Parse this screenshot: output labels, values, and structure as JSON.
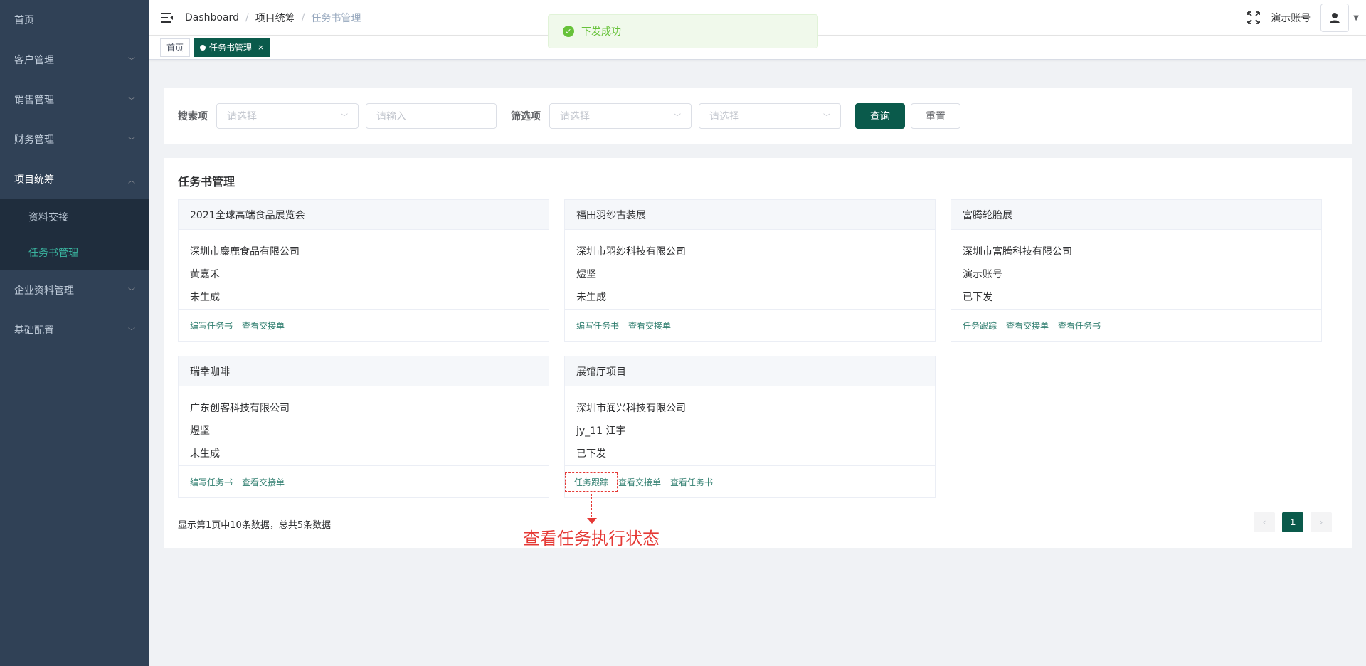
{
  "sidebar": {
    "items": [
      {
        "label": "首页",
        "has_children": false
      },
      {
        "label": "客户管理",
        "has_children": true
      },
      {
        "label": "销售管理",
        "has_children": true
      },
      {
        "label": "财务管理",
        "has_children": true
      },
      {
        "label": "项目统筹",
        "has_children": true,
        "open": true
      },
      {
        "label": "企业资料管理",
        "has_children": true
      },
      {
        "label": "基础配置",
        "has_children": true
      }
    ],
    "submenu": [
      {
        "label": "资料交接"
      },
      {
        "label": "任务书管理",
        "active": true
      }
    ]
  },
  "navbar": {
    "breadcrumb": [
      "Dashboard",
      "项目统筹",
      "任务书管理"
    ],
    "user_name": "演示账号"
  },
  "tags": [
    {
      "label": "首页"
    },
    {
      "label": "任务书管理",
      "active": true,
      "close": "×"
    }
  ],
  "toast": {
    "message": "下发成功",
    "color": "#67c23a"
  },
  "search": {
    "search_label": "搜索项",
    "select1_placeholder": "请选择",
    "input_placeholder": "请输入",
    "filter_label": "筛选项",
    "select2_placeholder": "请选择",
    "select3_placeholder": "请选择",
    "query_button": "查询",
    "reset_button": "重置"
  },
  "panel": {
    "title": "任务书管理"
  },
  "cards": [
    {
      "title": "2021全球高端食品展览会",
      "company": "深圳市麋鹿食品有限公司",
      "person": "黄嘉禾",
      "status": "未生成",
      "actions": [
        "编写任务书",
        "查看交接单"
      ]
    },
    {
      "title": "福田羽纱古装展",
      "company": "深圳市羽纱科技有限公司",
      "person": "煜坚",
      "status": "未生成",
      "actions": [
        "编写任务书",
        "查看交接单"
      ]
    },
    {
      "title": "富腾轮胎展",
      "company": "深圳市富腾科技有限公司",
      "person": "演示账号",
      "status": "已下发",
      "actions": [
        "任务跟踪",
        "查看交接单",
        "查看任务书"
      ]
    },
    {
      "title": "瑞幸咖啡",
      "company": "广东创客科技有限公司",
      "person": "煜坚",
      "status": "未生成",
      "actions": [
        "编写任务书",
        "查看交接单"
      ]
    },
    {
      "title": "展馆厅项目",
      "company": "深圳市润兴科技有限公司",
      "person": "jy_11 江宇",
      "status": "已下发",
      "actions": [
        "任务跟踪",
        "查看交接单",
        "查看任务书"
      ]
    }
  ],
  "pagination": {
    "info": "显示第1页中10条数据，总共5条数据",
    "prev": "‹",
    "current": "1",
    "next": "›"
  },
  "annotation": {
    "text": "查看任务执行状态",
    "color": "#e53935"
  },
  "colors": {
    "primary": "#0a5a4b",
    "sidebar_bg": "#304156",
    "link": "#2e7d6e"
  }
}
